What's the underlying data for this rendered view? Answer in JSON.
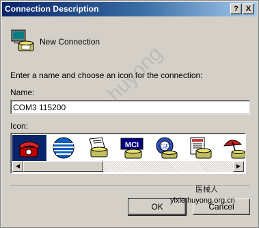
{
  "window": {
    "title": "Connection Description",
    "help_btn": "?",
    "close_btn": "X"
  },
  "connection": {
    "name": "New Connection",
    "icon": "phone-computer-icon"
  },
  "prompt": "Enter a name and choose an icon for the connection:",
  "name_field": {
    "label": "Name:",
    "value": "COM3 115200"
  },
  "icon_field": {
    "label": "Icon:",
    "icons": [
      {
        "name": "red-telephone-icon",
        "selected": true
      },
      {
        "name": "globe-icon"
      },
      {
        "name": "fax-phone-icon"
      },
      {
        "name": "mci-icon",
        "text": "MCI"
      },
      {
        "name": "ge-globe-icon",
        "text": "GE"
      },
      {
        "name": "document-phone-icon"
      },
      {
        "name": "umbrella-phone-icon"
      }
    ]
  },
  "buttons": {
    "ok": "OK",
    "cancel": "Cancel"
  },
  "watermark": {
    "main": "huyong",
    "cn": "医械人",
    "url": "yixie.huyong.org.cn"
  },
  "colors": {
    "titlebar_start": "#0a246a",
    "titlebar_end": "#a6caf0",
    "face": "#d4d0c8",
    "selection": "#0a246a"
  }
}
